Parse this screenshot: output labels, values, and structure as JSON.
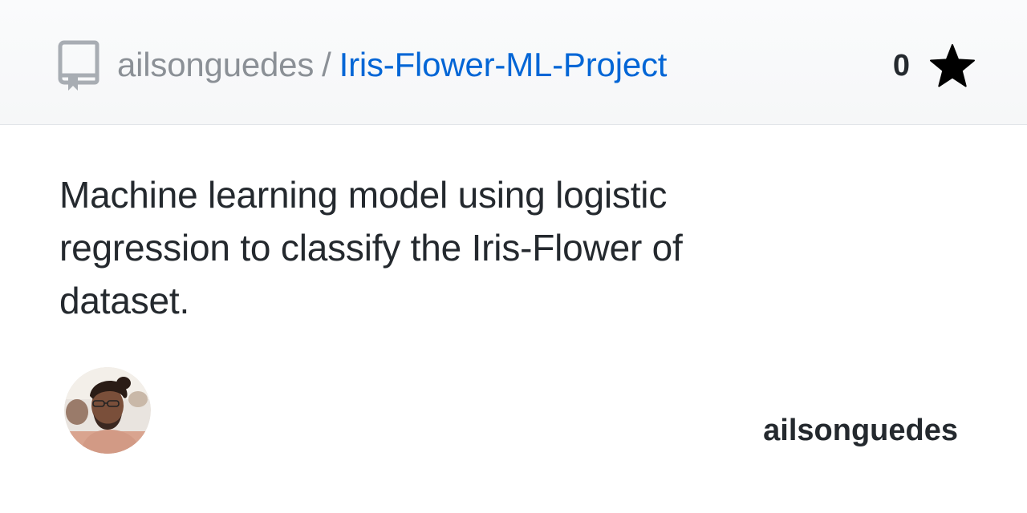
{
  "header": {
    "icon": "repo-icon",
    "owner": "ailsonguedes",
    "separator": "/",
    "repo_name": "Iris-Flower-ML-Project",
    "star_count": "0",
    "star_icon": "star-icon"
  },
  "description": "Machine learning model using logistic regression to classify the Iris-Flower of dataset.",
  "footer": {
    "avatar": "avatar",
    "username": "ailsonguedes"
  },
  "colors": {
    "link": "#0366d6",
    "muted": "#8b9096",
    "text": "#24292e"
  }
}
